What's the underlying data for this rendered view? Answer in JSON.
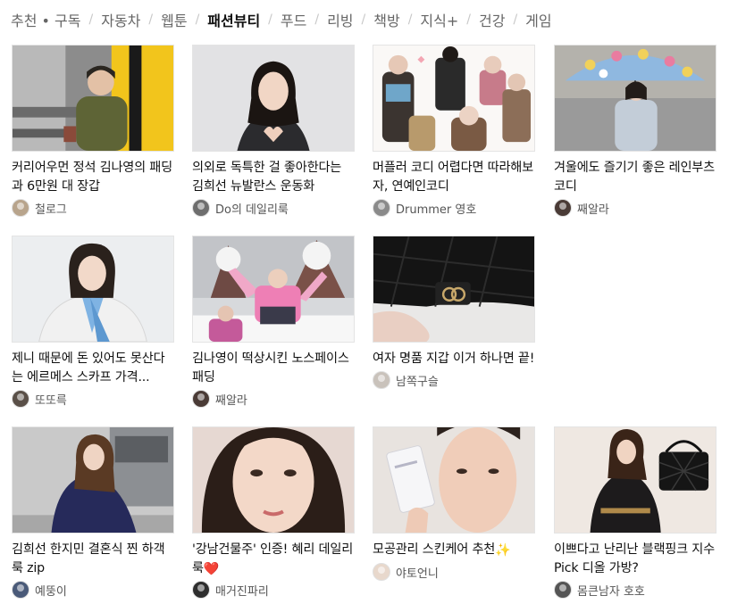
{
  "tabs": [
    {
      "label": "추천 • 구독",
      "active": false
    },
    {
      "label": "자동차",
      "active": false
    },
    {
      "label": "웹툰",
      "active": false
    },
    {
      "label": "패션뷰티",
      "active": true
    },
    {
      "label": "푸드",
      "active": false
    },
    {
      "label": "리빙",
      "active": false
    },
    {
      "label": "책방",
      "active": false
    },
    {
      "label": "지식+",
      "active": false
    },
    {
      "label": "건강",
      "active": false
    },
    {
      "label": "게임",
      "active": false
    }
  ],
  "separator": "/",
  "cards": [
    {
      "title": "커리어우먼 정석 김나영의 패딩과 6만원 대 장갑",
      "author": "철로그",
      "avatar_color": "#b8a48c",
      "image": "woman in olive puffer jacket, yellow wall"
    },
    {
      "title": "의외로 독특한 걸 좋아한다는 김희선 뉴발란스 운동화",
      "author": "Do의 데일리룩",
      "avatar_color": "#6e6e6e",
      "image": "woman making heart hands"
    },
    {
      "title": "머플러 코디 어렵다면 따라해보자, 연예인코디",
      "author": "Drummer 영호",
      "avatar_color": "#8a8a8a",
      "image": "collage of women in scarves"
    },
    {
      "title": "겨울에도 즐기기 좋은 레인부츠 코디",
      "author": "째알라",
      "avatar_color": "#4a3b36",
      "image": "woman with floral umbrella"
    },
    {
      "title": "제니 때문에 돈 있어도 못산다는 에르메스 스카프 가격...",
      "author": "또또륵",
      "avatar_color": "#5a5048",
      "image": "woman in white coat with blue scarf"
    },
    {
      "title": "김나영이 떡상시킨 노스페이스 패딩",
      "author": "째알라",
      "avatar_color": "#4a3b36",
      "image": "kids in pink padding in snow"
    },
    {
      "title": "여자 명품 지갑 이거 하나면 끝!",
      "author": "남쪽구슬",
      "avatar_color": "#c9c2bb",
      "image": "black quilted wallet"
    },
    {
      "title": "김희선 한지민 결혼식 찐 하객룩 zip",
      "author": "예뚱이",
      "avatar_color": "#4a5a78",
      "image": "woman in navy dress"
    },
    {
      "title": "'강남건물주' 인증! 혜리 데일리룩",
      "title_emoji": "❤️",
      "author": "매거진파리",
      "avatar_color": "#2e2e2e",
      "image": "close-up portrait"
    },
    {
      "title": "모공관리 스킨케어 추천",
      "title_emoji": "✨",
      "author": "야토언니",
      "avatar_color": "#e8d8cc",
      "image": "woman holding skincare bottle"
    },
    {
      "title": "이쁘다고 난리난 블랙핑크 지수 Pick 디올 가방?",
      "author": "몸큰남자 호호",
      "avatar_color": "#555555",
      "image": "woman with black dior bag"
    }
  ]
}
